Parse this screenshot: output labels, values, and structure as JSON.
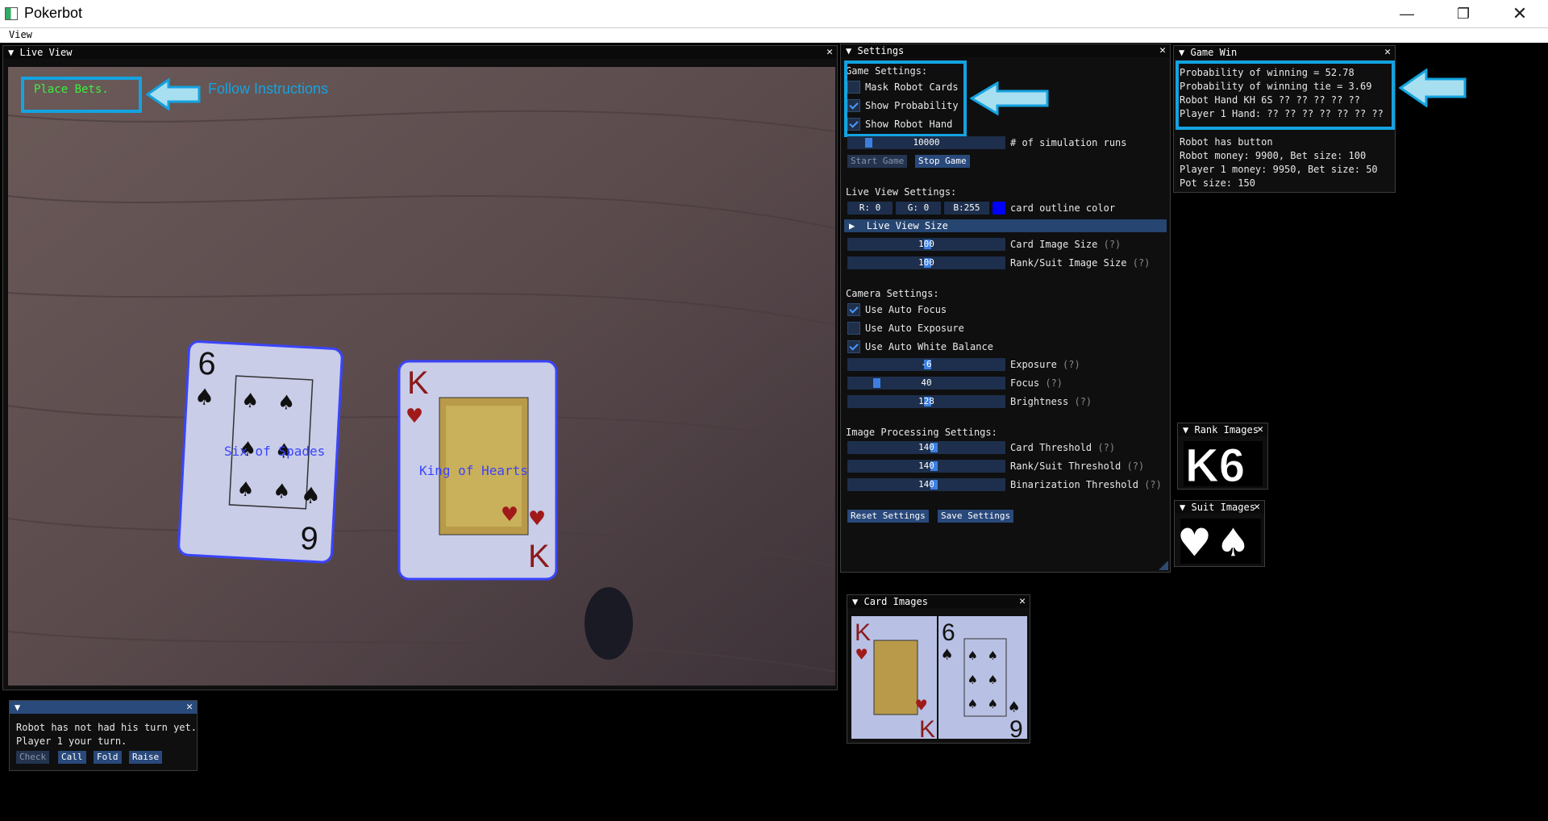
{
  "app": {
    "title": "Pokerbot"
  },
  "menu": {
    "view": "View"
  },
  "live_view": {
    "title": "Live View",
    "overlay_message": "Place Bets.",
    "annotation": "Follow Instructions",
    "card1_label": "Six of Spades",
    "card2_label": "King of Hearts"
  },
  "settings": {
    "title": "Settings",
    "game_settings": "Game Settings:",
    "mask_robot_cards": "Mask Robot Cards",
    "mask_robot_cards_checked": false,
    "show_probability": "Show Probability",
    "show_probability_checked": true,
    "show_robot_hand": "Show Robot Hand",
    "show_robot_hand_checked": true,
    "simulation_runs_value": "10000",
    "simulation_runs_label": "# of simulation runs",
    "start_game": "Start Game",
    "stop_game": "Stop Game",
    "live_view_settings": "Live View Settings:",
    "r": "R:  0",
    "g": "G:  0",
    "b": "B:255",
    "outline_color": "#0000ff",
    "card_outline_label": "card outline color",
    "live_view_size": "Live View Size",
    "card_image_size_value": "100",
    "card_image_size_label": "Card Image Size",
    "help": "(?)",
    "rank_suit_image_size_value": "100",
    "rank_suit_image_size_label": "Rank/Suit Image Size",
    "camera_settings": "Camera Settings:",
    "auto_focus": "Use Auto Focus",
    "auto_focus_checked": true,
    "auto_exposure": "Use Auto Exposure",
    "auto_exposure_checked": false,
    "auto_white_balance": "Use Auto White Balance",
    "auto_white_balance_checked": true,
    "exposure_value": "-6",
    "exposure_label": "Exposure",
    "focus_value": "40",
    "focus_label": "Focus",
    "brightness_value": "128",
    "brightness_label": "Brightness",
    "image_processing_settings": "Image Processing Settings:",
    "card_threshold_value": "140",
    "card_threshold_label": "Card Threshold",
    "rank_suit_threshold_value": "140",
    "rank_suit_threshold_label": "Rank/Suit Threshold",
    "binarization_threshold_value": "140",
    "binarization_threshold_label": "Binarization Threshold",
    "reset_settings": "Reset Settings",
    "save_settings": "Save Settings"
  },
  "game_win": {
    "title": "Game Win",
    "prob_win": "Probability of winning = 52.78",
    "prob_tie": "Probability of winning tie = 3.69",
    "robot_hand": "Robot Hand KH 6S ?? ?? ?? ?? ??",
    "player1_hand": "Player 1 Hand: ?? ?? ?? ?? ?? ?? ??",
    "button": "Robot has button",
    "robot_money": "Robot money: 9900, Bet size: 100",
    "player1_money": "Player 1 money: 9950, Bet size: 50",
    "pot": "Pot size: 150"
  },
  "rank_images": {
    "title": "Rank Images",
    "ranks": "K6"
  },
  "suit_images": {
    "title": "Suit Images"
  },
  "card_images": {
    "title": "Card Images"
  },
  "turn": {
    "line1": "Robot has not had his turn yet.",
    "line2": "Player 1 your turn.",
    "check": "Check",
    "call": "Call",
    "fold": "Fold",
    "raise": "Raise"
  }
}
